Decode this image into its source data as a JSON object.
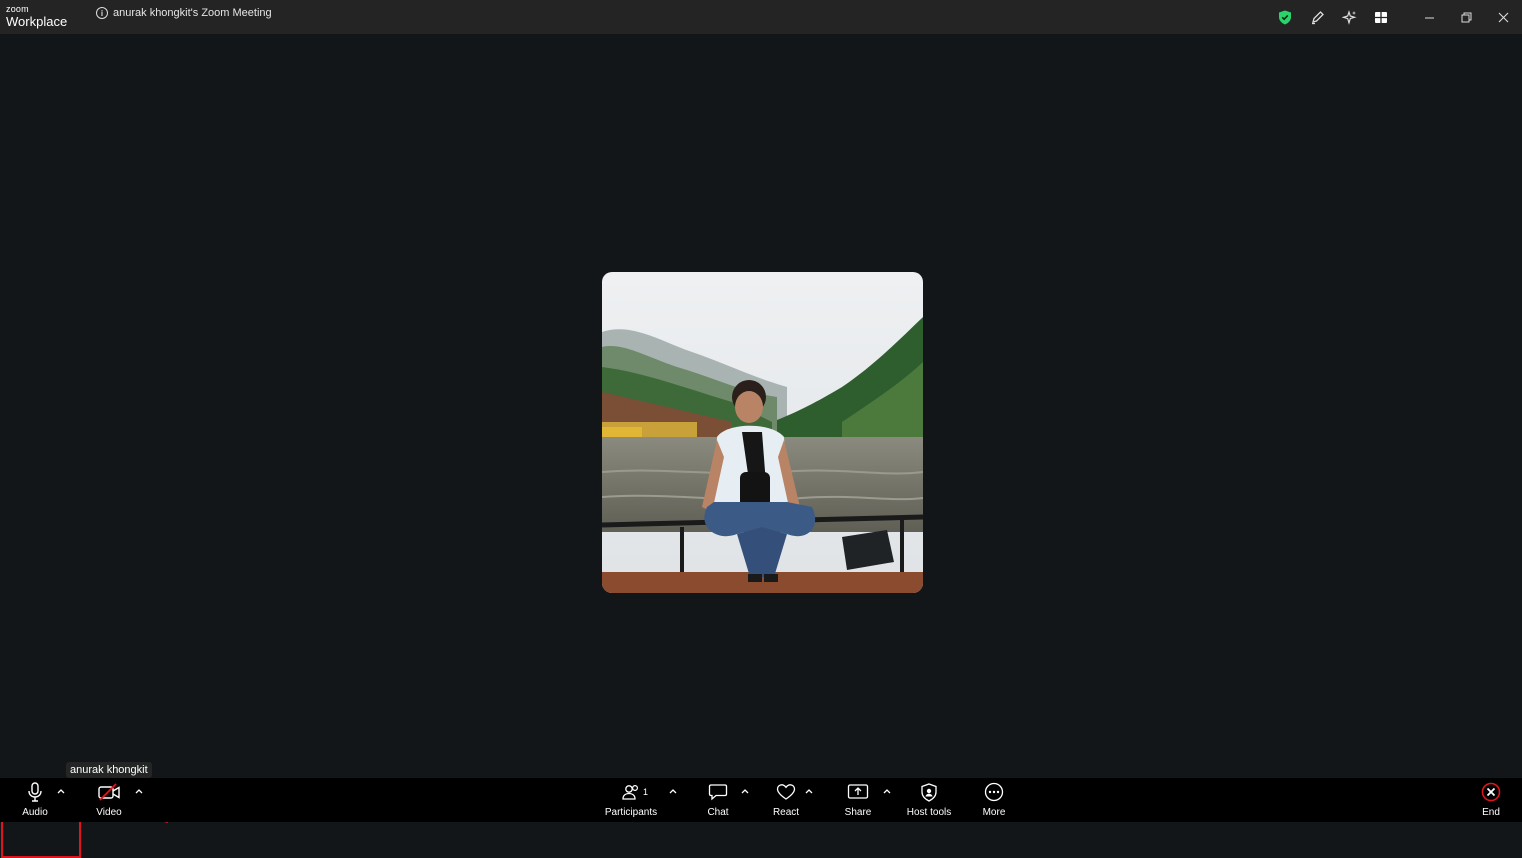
{
  "app": {
    "logo_top": "zoom",
    "logo_bottom": "Workplace"
  },
  "meeting": {
    "title": "anurak khongkit's Zoom Meeting"
  },
  "participant": {
    "name": "anurak khongkit"
  },
  "toolbar": {
    "audio_label": "Audio",
    "video_label": "Video",
    "participants_label": "Participants",
    "participants_count": "1",
    "chat_label": "Chat",
    "react_label": "React",
    "share_label": "Share",
    "host_tools_label": "Host tools",
    "more_label": "More",
    "end_label": "End"
  },
  "titlebar_icons": [
    "shield-check-icon",
    "edit-pen-icon",
    "sparkle-ai-icon",
    "apps-grid-icon"
  ],
  "colors": {
    "accent_green": "#2bd46a",
    "end_red": "#e0141c",
    "annotation_red": "#e0141c"
  }
}
